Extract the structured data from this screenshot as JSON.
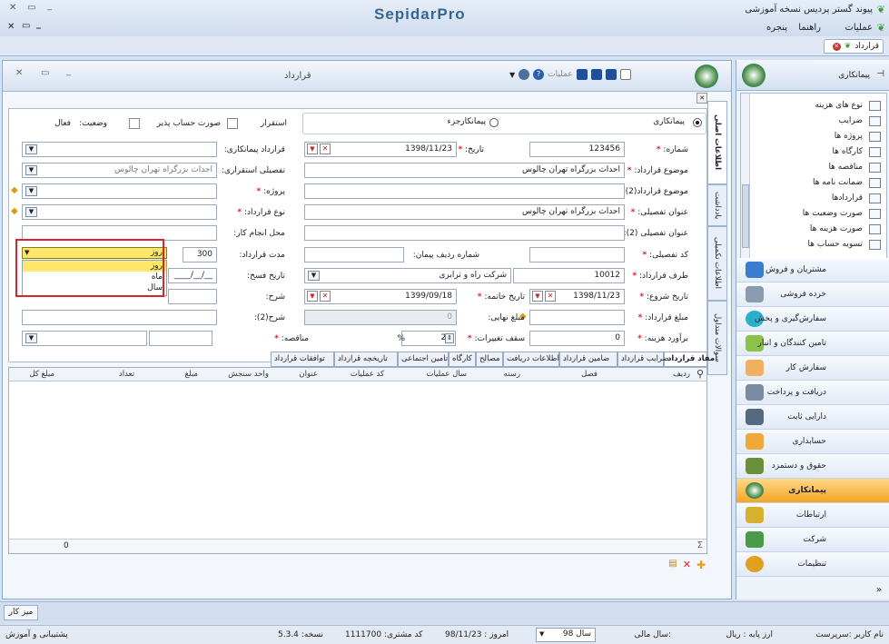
{
  "app": {
    "title": "پیوند گستر پردیس نسخه آموزشی",
    "brand": "SepidarPro"
  },
  "menu": [
    "عملیات",
    "راهنما",
    "پنجره"
  ],
  "doc_tab": "قرارداد",
  "window": {
    "title": "قرارداد",
    "toolbar_ops": "عملیات"
  },
  "sidebar": {
    "title": "پیمانکاری",
    "tree": [
      "نوع های هزینه",
      "ضرایب",
      "پروژه ها",
      "کارگاه ها",
      "مناقصه ها",
      "ضمانت نامه ها",
      "قراردادها",
      "صورت وضعیت ها",
      "صورت هزینه ها",
      "تسویه حساب ها"
    ],
    "modules": [
      "مشتریان و فروش",
      "خرده فروشی",
      "سفارش‌گیری و پخش",
      "تامین کنندگان و انبار",
      "سفارش کار",
      "دریافت و پرداخت",
      "دارایی ثابت",
      "حسابداری",
      "حقوق و دستمزد",
      "پیمانکاری",
      "ارتباطات",
      "شرکت",
      "تنظیمات"
    ],
    "active": "پیمانکاری"
  },
  "vtabs": [
    "اطلاعات اصلی",
    "یادداشت",
    "اطلاعات تکمیلی",
    "سوالات متداول"
  ],
  "form": {
    "type_contractor": "پیمانکاری",
    "type_subcontractor": "پیمانکارجزء",
    "lbl_stable": "استقرار",
    "lbl_billable": "صورت حساب پذیر",
    "lbl_status": "وضعیت:",
    "status": "فعال",
    "lbl_number": "شماره:",
    "number": "123456",
    "lbl_date": "تاریخ:",
    "date": "1398/11/23",
    "lbl_contractor_contract": "قرارداد پیمانکاری:",
    "lbl_subject": "موضوع قرارداد:",
    "subject": "احداث بزرگراه تهران چالوس",
    "lbl_detail_stable": "تفصیلی استقراری:",
    "detail_stable": "احداث بزرگراه تهران چالوس",
    "lbl_subject2": "موضوع قرارداد(2):",
    "lbl_project": "پروژه:",
    "lbl_detail_title": "عنوان تفصیلی:",
    "detail_title": "احداث بزرگراه تهران چالوس",
    "lbl_contract_type": "نوع قرارداد:",
    "lbl_detail_title2": "عنوان تفصیلی (2):",
    "lbl_workplace": "محل انجام کار:",
    "lbl_detail_code": "کد تفصیلی:",
    "lbl_contract_row": "شماره ردیف پیمان:",
    "lbl_duration": "مدت قرارداد:",
    "duration": "300",
    "duration_unit": "روز",
    "duration_options": [
      "روز",
      "ماه",
      "سال"
    ],
    "lbl_party": "طرف قرارداد:",
    "party_code": "10012",
    "party_name": "شرکت راه و ترابری",
    "lbl_cancel_date": "تاریخ فسخ:",
    "cancel_date": "__/__/____",
    "lbl_start": "تاریخ شروع:",
    "start": "1398/11/23",
    "lbl_end": "تاریخ خاتمه:",
    "end": "1399/09/18",
    "lbl_desc": "شرح:",
    "lbl_amount": "مبلغ قرارداد:",
    "lbl_final": "مبلغ نهایی:",
    "final": "0",
    "lbl_desc2": "شرح(2):",
    "lbl_estimate": "برآورد هزینه:",
    "estimate": "0",
    "lbl_ceiling": "سقف تغییرات:",
    "ceiling": "25",
    "pct": "%",
    "lbl_tender": "مناقصه:"
  },
  "grid_tabs": [
    "مفاد قرارداد",
    "ضرایب قرارداد",
    "ضامین قرارداد",
    "اطلاعات دریافت",
    "مصالح",
    "کارگاه",
    "تامین اجتماعی",
    "تاریخچه قرارداد",
    "توافقات قرارداد"
  ],
  "grid_cols": [
    "ردیف",
    "فصل",
    "رسته",
    "سال عملیات",
    "کد عملیات",
    "عنوان",
    "واحد سنجش",
    "مبلغ",
    "تعداد",
    "مبلغ کل"
  ],
  "grid_total": "0",
  "taskbar": "میز کار",
  "status": {
    "user_label": "نام کاربر :",
    "user": "سرپرست",
    "currency_label": "ارز پایه :",
    "currency": "ریال",
    "fiscal_label": "سال مالی:",
    "fiscal": "سال 98",
    "today_label": "امروز :",
    "today": "98/11/23",
    "customer_label": "کد مشتری:",
    "customer": "1111700",
    "version_label": "نسخه:",
    "version": "5.3.4",
    "support": "پشتیبانی و آموزش"
  },
  "colors": {
    "accent": "#f5a623",
    "highlight": "#d6262c",
    "select": "#ffe76a"
  }
}
